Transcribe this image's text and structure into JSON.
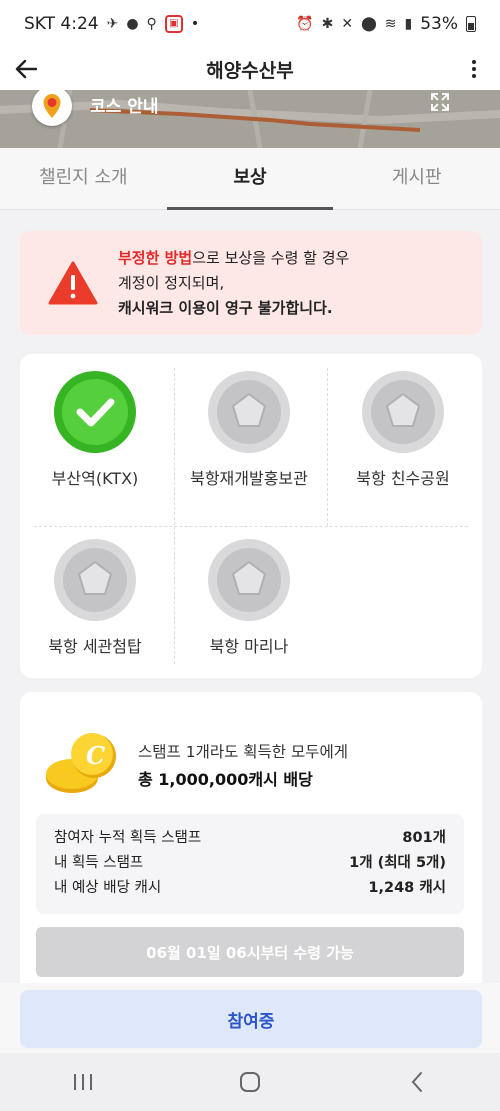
{
  "status_bar": {
    "carrier_time": "SKT 4:24",
    "battery": "53%"
  },
  "app_bar": {
    "title": "해양수산부"
  },
  "map": {
    "label": "코스 안내"
  },
  "tabs": [
    {
      "label": "챌린지 소개",
      "active": false
    },
    {
      "label": "보상",
      "active": true
    },
    {
      "label": "게시판",
      "active": false
    }
  ],
  "warning": {
    "part1_red": "부정한 방법",
    "part1_rest": "으로 보상을 수령 할 경우",
    "line2": "계정이 정지되며,",
    "line3": "캐시워크 이용이 영구 불가합니다."
  },
  "stamps": [
    {
      "label": "부산역(KTX)",
      "obtained": true
    },
    {
      "label": "북항재개발홍보관",
      "obtained": false
    },
    {
      "label": "북항 친수공원",
      "obtained": false
    },
    {
      "label": "북항 세관첨탑",
      "obtained": false
    },
    {
      "label": "북항 마리나",
      "obtained": false
    }
  ],
  "reward": {
    "line1": "스탬프 1개라도 획득한 모두에게",
    "line2": "총 1,000,000캐시 배당",
    "stats": [
      {
        "label": "참여자 누적 획득 스탬프",
        "value": "801개"
      },
      {
        "label": "내 획득 스탬프",
        "value": "1개 (최대 5개)"
      },
      {
        "label": "내 예상 배당 캐시",
        "value": "1,248 캐시"
      }
    ],
    "claim_label": "06월 01일 06시부터 수령 가능"
  },
  "join_button": "참여중",
  "colors": {
    "warning_red": "#e32a2a",
    "stamp_green": "#3fbf2a",
    "join_blue": "#2c56c7"
  }
}
